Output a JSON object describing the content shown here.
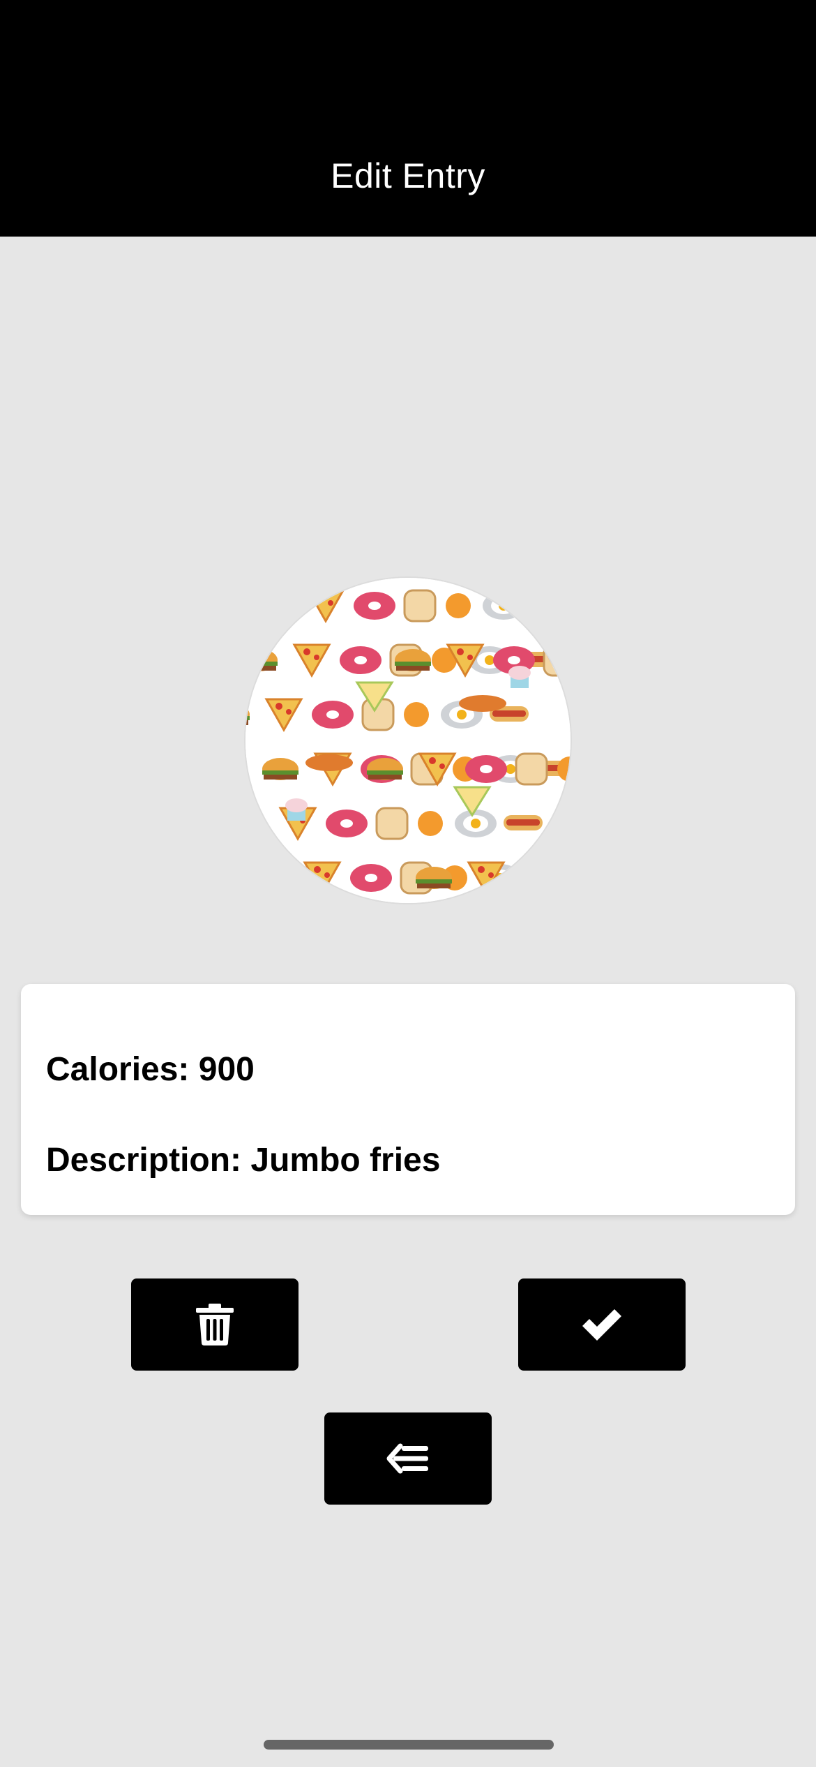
{
  "header": {
    "title": "Edit Entry"
  },
  "entry": {
    "calories_label": "Calories: 900",
    "description_label": "Description: Jumbo fries"
  },
  "actions": {
    "delete_icon": "trash-icon",
    "save_icon": "check-icon",
    "back_icon": "back-arrow-list-icon"
  },
  "colors": {
    "header_bg": "#000000",
    "page_bg": "#e6e6e6",
    "card_bg": "#ffffff",
    "button_bg": "#000000",
    "icon_color": "#ffffff"
  }
}
